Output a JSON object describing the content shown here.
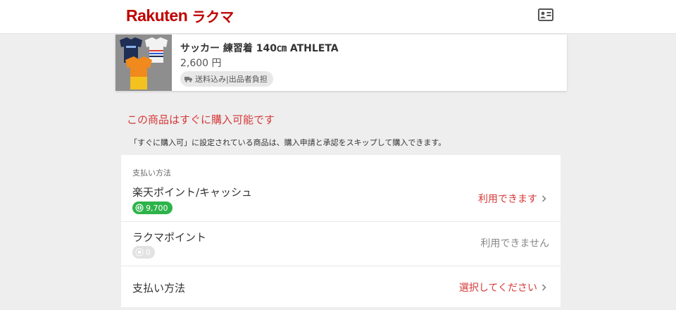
{
  "header": {
    "logo_rakuten": "Rakuten",
    "logo_rakuma": "ラクマ",
    "icon": "profile-card-icon",
    "brand_color": "#bf0000"
  },
  "product": {
    "title": "サッカー 練習着 140㎝ ATHLETA",
    "price": "2,600 円",
    "shipping": "送料込み|出品者負担",
    "shipping_icon": "truck-icon"
  },
  "notice": {
    "title": "この商品はすぐに購入可能です",
    "body": "「すぐに購入可」に設定されている商品は、購入申請と承認をスキップして購入できます。",
    "color": "#d63838"
  },
  "payment": {
    "section_label": "支払い方法",
    "rakuten_points": {
      "label": "楽天ポイント/キャッシュ",
      "balance": "9,700",
      "status": "利用できます",
      "badge_color": "#2db34a"
    },
    "rakuma_points": {
      "label": "ラクマポイント",
      "balance": "0",
      "status": "利用できません"
    },
    "method": {
      "label": "支払い方法",
      "action": "選択してください"
    }
  }
}
